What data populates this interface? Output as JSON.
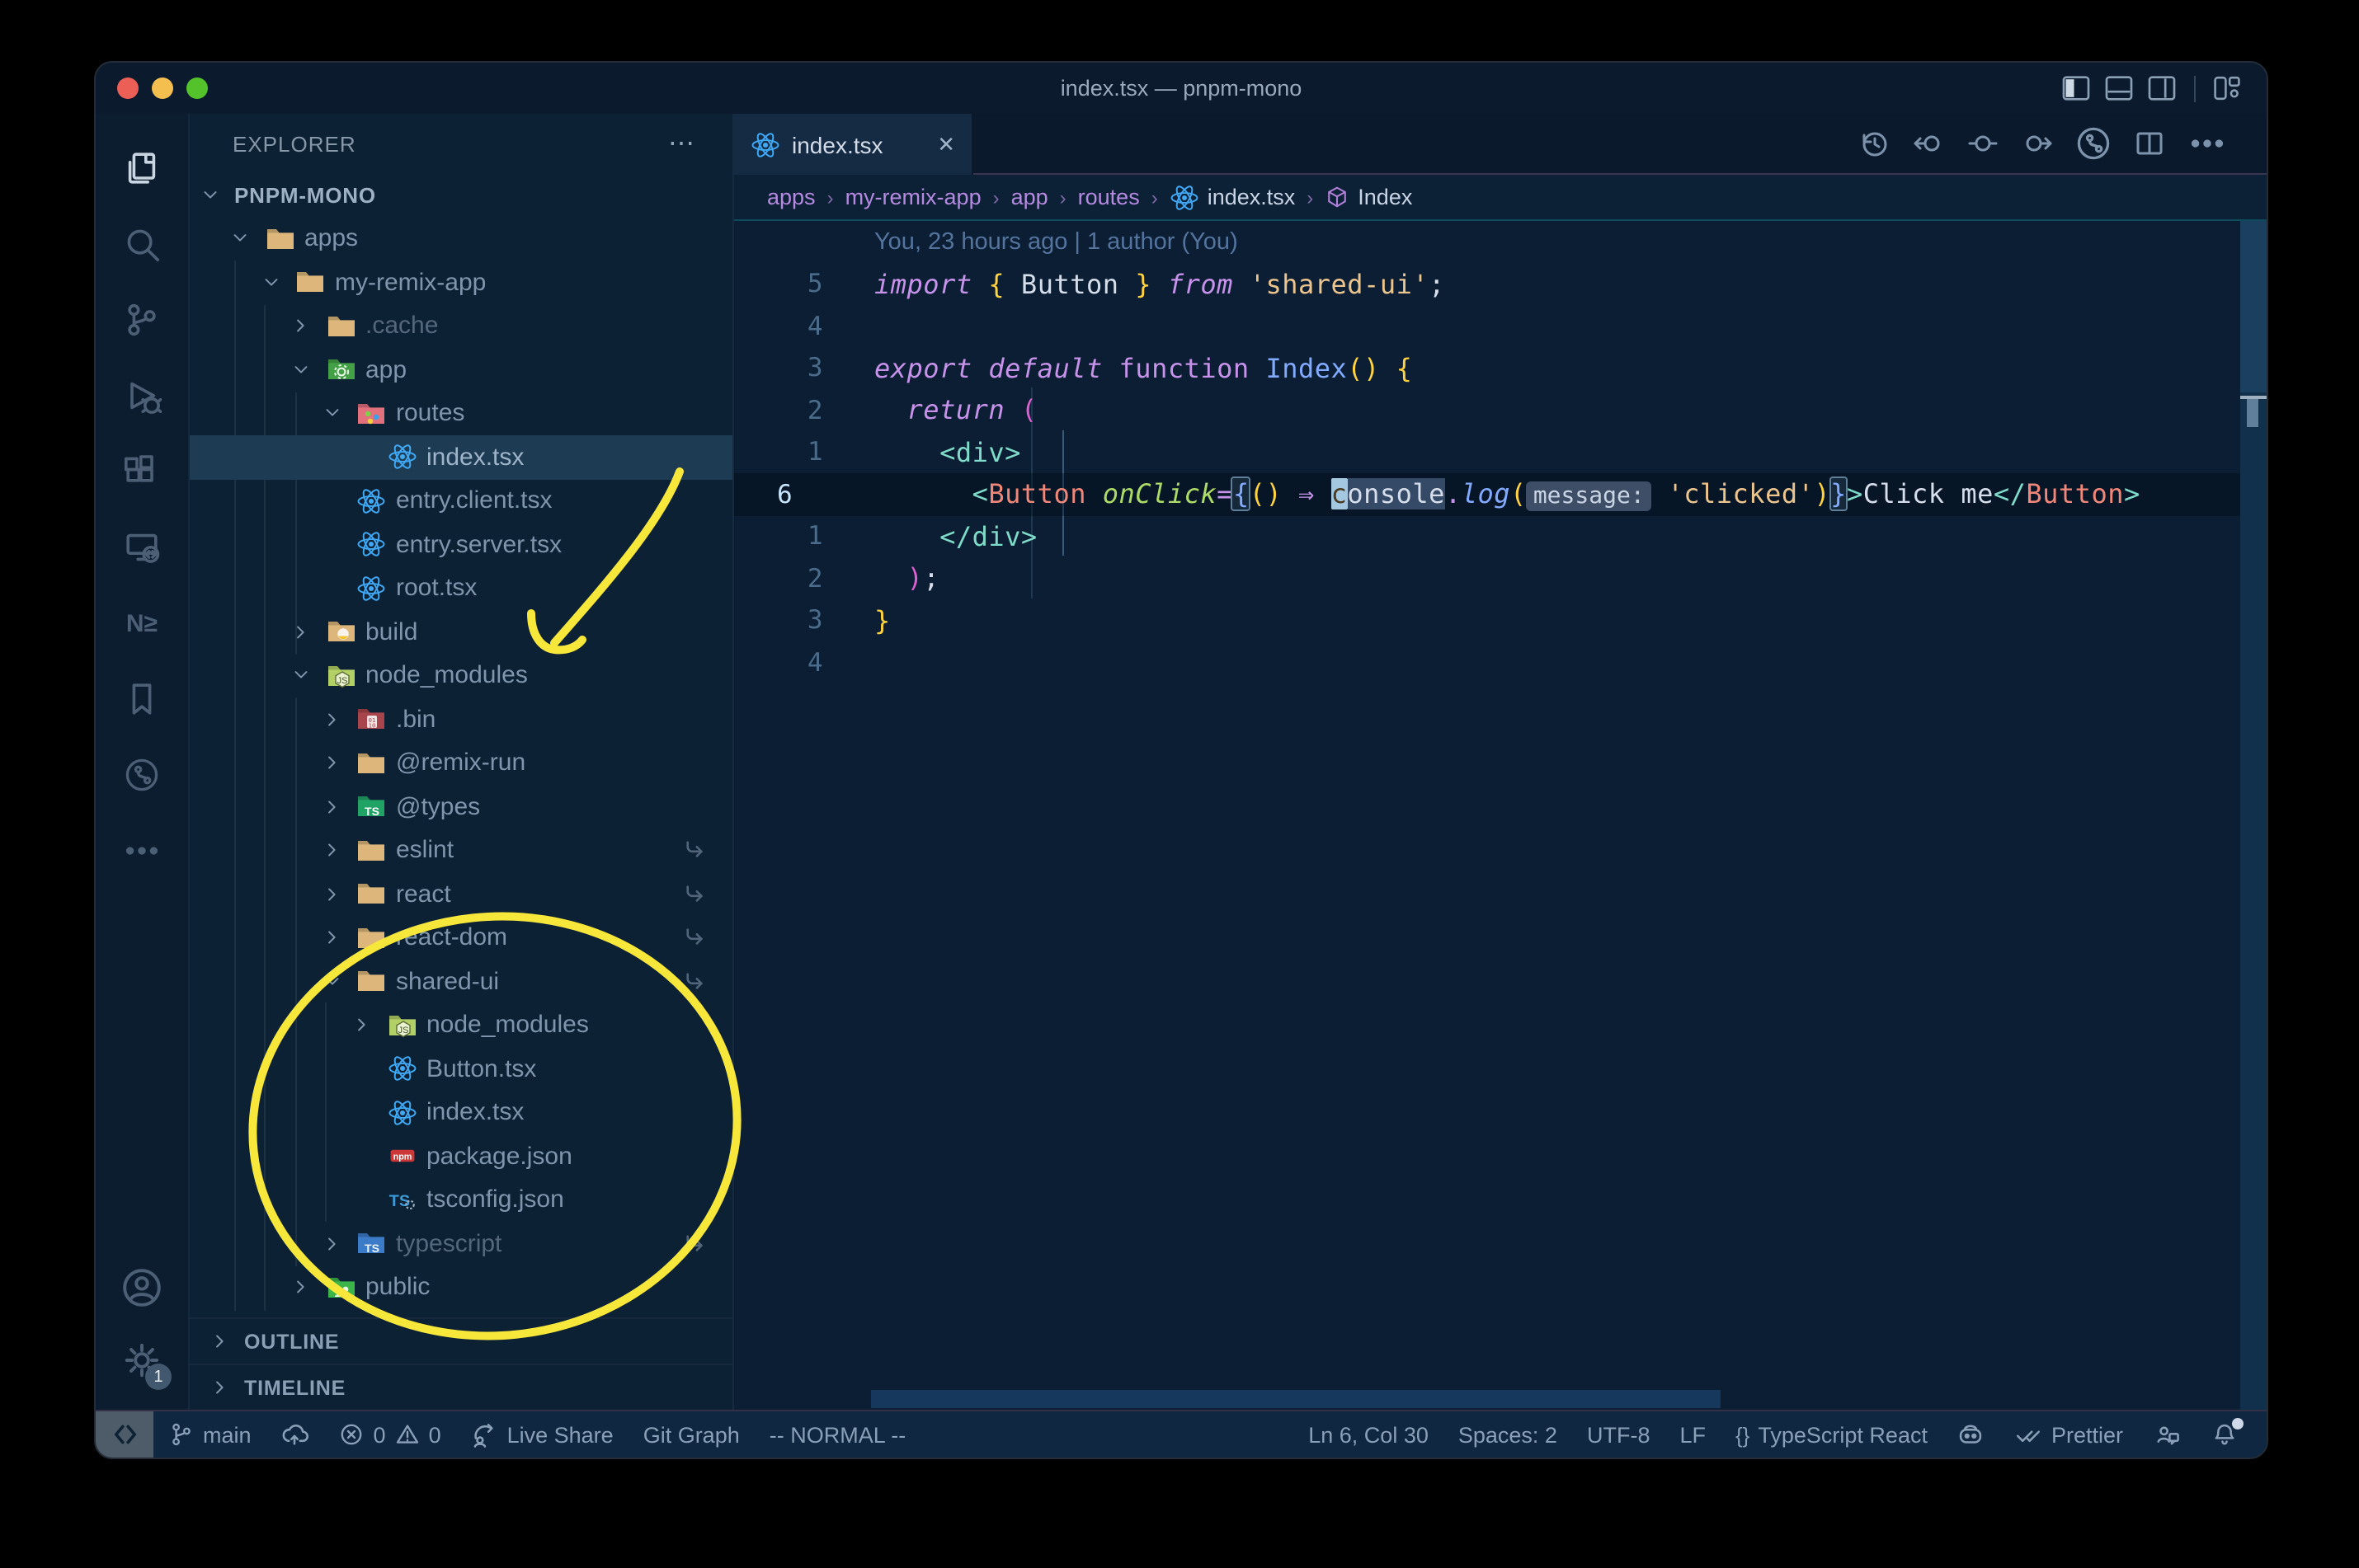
{
  "window": {
    "title": "index.tsx — pnpm-mono"
  },
  "colors": {
    "titlebar-bg": "#0b1b2d",
    "tabbar-bg": "#0a192b",
    "tab-bg": "#152b43",
    "activity-bg": "#0c1d30",
    "sidebar-bg": "#0d2134",
    "editor-bg": "#0b1e33",
    "breadcrumb-bg": "#0c2036",
    "status-bg": "#0f2740",
    "row-sel": "#1d3b53",
    "c-kw": "#c792ea",
    "c-str": "#ecc48d",
    "c-fn": "#82aaff",
    "c-tag": "#7fdbca",
    "c-comp": "#f08779",
    "c-attr": "#addb67",
    "c-gold": "#ffd23f",
    "c-pink": "#de5fd0",
    "code-fg": "#d6deeb",
    "lnum": "#4a6b8a",
    "lnum-cur": "#c5e4fd",
    "blame": "#54749e",
    "inlay-bg": "#3e4e66",
    "inlay-fg": "#c9d4e4",
    "hl-bg": "#354a66",
    "cursor-bg": "#a3c8e0",
    "guide": "#1d3a52",
    "guide-active": "#3a5a78",
    "bc-fg": "#b58ae0",
    "react-blue": "#3fa9f5",
    "annotation-yellow": "#f7e73a",
    "traffic-red": "#ec5f57",
    "traffic-yellow": "#f5bf4f",
    "traffic-green": "#53c22b"
  },
  "titlebar_icons": [
    {
      "name": "toggle-primary-sidebar-icon"
    },
    {
      "name": "toggle-panel-icon"
    },
    {
      "name": "toggle-secondary-sidebar-icon"
    },
    {
      "name": "customize-layout-icon"
    }
  ],
  "activity_bar": {
    "items": [
      {
        "name": "explorer-icon",
        "icon": "files",
        "active": true
      },
      {
        "name": "search-icon",
        "icon": "search"
      },
      {
        "name": "source-control-icon",
        "icon": "scm"
      },
      {
        "name": "run-debug-icon",
        "icon": "debug"
      },
      {
        "name": "extensions-icon",
        "icon": "extensions"
      },
      {
        "name": "remote-explorer-icon",
        "icon": "remote-explorer"
      },
      {
        "name": "nx-console-icon",
        "icon": "nx",
        "glyph": "N≥"
      },
      {
        "name": "bookmarks-icon",
        "icon": "bookmark"
      },
      {
        "name": "git-graph-icon",
        "icon": "gitcircle"
      },
      {
        "name": "more-views-icon",
        "icon": "ellipsis"
      }
    ],
    "bottom": [
      {
        "name": "account-icon",
        "icon": "account"
      },
      {
        "name": "settings-gear-icon",
        "icon": "gear",
        "badge": "1"
      }
    ]
  },
  "sidebar": {
    "header": {
      "title": "EXPLORER",
      "more": "⋯"
    },
    "tree": [
      {
        "label": "PNPM-MONO",
        "level": 0,
        "chevron": "down",
        "icon": "",
        "root": true
      },
      {
        "label": "apps",
        "level": 1,
        "chevron": "down",
        "icon": "folder-tan"
      },
      {
        "label": "my-remix-app",
        "level": 2,
        "chevron": "down",
        "icon": "folder-tan"
      },
      {
        "label": ".cache",
        "level": 3,
        "chevron": "right",
        "icon": "folder-tan",
        "dim": true
      },
      {
        "label": "app",
        "level": 3,
        "chevron": "down",
        "icon": "folder-app"
      },
      {
        "label": "routes",
        "level": 4,
        "chevron": "down",
        "icon": "folder-routes"
      },
      {
        "label": "index.tsx",
        "level": 5,
        "chevron": "none",
        "icon": "react",
        "selected": true
      },
      {
        "label": "entry.client.tsx",
        "level": 4,
        "chevron": "none",
        "icon": "react"
      },
      {
        "label": "entry.server.tsx",
        "level": 4,
        "chevron": "none",
        "icon": "react"
      },
      {
        "label": "root.tsx",
        "level": 4,
        "chevron": "none",
        "icon": "react"
      },
      {
        "label": "build",
        "level": 3,
        "chevron": "right",
        "icon": "folder-build"
      },
      {
        "label": "node_modules",
        "level": 3,
        "chevron": "down",
        "icon": "folder-node"
      },
      {
        "label": ".bin",
        "level": 4,
        "chevron": "right",
        "icon": "folder-bin"
      },
      {
        "label": "@remix-run",
        "level": 4,
        "chevron": "right",
        "icon": "folder-tan"
      },
      {
        "label": "@types",
        "level": 4,
        "chevron": "right",
        "icon": "folder-types"
      },
      {
        "label": "eslint",
        "level": 4,
        "chevron": "right",
        "icon": "folder-tan",
        "symlink": true
      },
      {
        "label": "react",
        "level": 4,
        "chevron": "right",
        "icon": "folder-tan",
        "symlink": true
      },
      {
        "label": "react-dom",
        "level": 4,
        "chevron": "right",
        "icon": "folder-tan",
        "symlink": true
      },
      {
        "label": "shared-ui",
        "level": 4,
        "chevron": "down",
        "icon": "folder-tan",
        "symlink": true
      },
      {
        "label": "node_modules",
        "level": 5,
        "chevron": "right",
        "icon": "folder-node"
      },
      {
        "label": "Button.tsx",
        "level": 5,
        "chevron": "none",
        "icon": "react"
      },
      {
        "label": "index.tsx",
        "level": 5,
        "chevron": "none",
        "icon": "react"
      },
      {
        "label": "package.json",
        "level": 5,
        "chevron": "none",
        "icon": "npm"
      },
      {
        "label": "tsconfig.json",
        "level": 5,
        "chevron": "none",
        "icon": "tsconfig"
      },
      {
        "label": "typescript",
        "level": 4,
        "chevron": "right",
        "icon": "folder-ts",
        "dim": true,
        "symlink": true
      },
      {
        "label": "public",
        "level": 3,
        "chevron": "right",
        "icon": "folder-public"
      }
    ],
    "sections": [
      {
        "label": "OUTLINE"
      },
      {
        "label": "TIMELINE"
      }
    ]
  },
  "tabs": [
    {
      "label": "index.tsx",
      "icon": "react",
      "close": "✕",
      "active": true
    }
  ],
  "editor_toolbar": [
    {
      "name": "timeline-history-icon",
      "icon": "history"
    },
    {
      "name": "previous-change-icon",
      "icon": "prevchange"
    },
    {
      "name": "current-change-icon",
      "icon": "circle"
    },
    {
      "name": "next-change-icon",
      "icon": "nextchange"
    },
    {
      "name": "open-changes-icon",
      "icon": "gitcircle"
    },
    {
      "name": "split-editor-icon",
      "icon": "split"
    },
    {
      "name": "more-actions-icon",
      "icon": "ellipsis"
    }
  ],
  "breadcrumbs": {
    "separator": "›",
    "items": [
      {
        "label": "apps"
      },
      {
        "label": "my-remix-app"
      },
      {
        "label": "app"
      },
      {
        "label": "routes"
      },
      {
        "label": "index.tsx",
        "icon": "react",
        "bright": true
      },
      {
        "label": "Index",
        "icon": "symbol-cube",
        "bright": true
      }
    ]
  },
  "editor": {
    "blame": "You, 23 hours ago | 1 author (You)",
    "current_line_number": "6",
    "lines": [
      {
        "num": "5",
        "tokens": [
          [
            "kw",
            "import"
          ],
          [
            "txt",
            " "
          ],
          [
            "gold",
            "{"
          ],
          [
            "txt",
            " Button "
          ],
          [
            "gold",
            "}"
          ],
          [
            "txt",
            " "
          ],
          [
            "kw",
            "from"
          ],
          [
            "txt",
            " "
          ],
          [
            "str",
            "'shared-ui'"
          ],
          [
            "txt",
            ";"
          ]
        ]
      },
      {
        "num": "4",
        "tokens": []
      },
      {
        "num": "3",
        "tokens": [
          [
            "kw",
            "export"
          ],
          [
            "txt",
            " "
          ],
          [
            "kw",
            "default"
          ],
          [
            "txt",
            " "
          ],
          [
            "kwn",
            "function"
          ],
          [
            "txt",
            " "
          ],
          [
            "fn",
            "Index"
          ],
          [
            "gold",
            "()"
          ],
          [
            "txt",
            " "
          ],
          [
            "gold",
            "{"
          ]
        ]
      },
      {
        "num": "2",
        "tokens": [
          [
            "txt",
            "  "
          ],
          [
            "kw",
            "return"
          ],
          [
            "txt",
            " "
          ],
          [
            "pink",
            "("
          ]
        ]
      },
      {
        "num": "1",
        "tokens": [
          [
            "txt",
            "    "
          ],
          [
            "tag",
            "<div>"
          ]
        ]
      },
      {
        "num": "6",
        "current": true,
        "tokens": [
          [
            "txt",
            "      "
          ],
          [
            "tag",
            "<"
          ],
          [
            "comp",
            "Button"
          ],
          [
            "txt",
            " "
          ],
          [
            "attr",
            "onClick"
          ],
          [
            "op",
            "="
          ],
          [
            "matchL",
            "{"
          ],
          [
            "gold",
            "()"
          ],
          [
            "txt",
            " "
          ],
          [
            "arrow",
            "⇒"
          ],
          [
            "txt",
            " "
          ],
          [
            "cursor",
            "c"
          ],
          [
            "hl",
            "onsole"
          ],
          [
            "op",
            "."
          ],
          [
            "fni",
            "log"
          ],
          [
            "gold",
            "("
          ],
          [
            "inlay",
            "message:"
          ],
          [
            "txt",
            " "
          ],
          [
            "str",
            "'clicked'"
          ],
          [
            "gold",
            ")"
          ],
          [
            "matchR",
            "}"
          ],
          [
            "tag",
            ">"
          ],
          [
            "txt",
            "Click me"
          ],
          [
            "tag",
            "</"
          ],
          [
            "comp",
            "Button"
          ],
          [
            "tag",
            ">"
          ]
        ]
      },
      {
        "num": "1",
        "tokens": [
          [
            "txt",
            "    "
          ],
          [
            "tag",
            "</div>"
          ]
        ]
      },
      {
        "num": "2",
        "tokens": [
          [
            "txt",
            "  "
          ],
          [
            "pink",
            ")"
          ],
          [
            "txt",
            ";"
          ]
        ]
      },
      {
        "num": "3",
        "tokens": [
          [
            "gold",
            "}"
          ]
        ]
      },
      {
        "num": "4",
        "tokens": []
      }
    ]
  },
  "statusbar": {
    "left": [
      {
        "name": "remote-indicator",
        "icon": "remote",
        "remote_box": true
      },
      {
        "name": "git-branch-item",
        "icon": "branch",
        "label": "main"
      },
      {
        "name": "sync-publish-item",
        "icon": "cloud-upload"
      },
      {
        "name": "problems-item",
        "icon": "error",
        "label": "0",
        "icon2": "warning",
        "label2": "0"
      },
      {
        "name": "live-share-item",
        "icon": "liveshare",
        "label": "Live Share"
      },
      {
        "name": "git-graph-item",
        "label": "Git Graph"
      },
      {
        "name": "vim-mode-item",
        "label": "-- NORMAL --"
      }
    ],
    "right": [
      {
        "name": "cursor-position-item",
        "label": "Ln 6, Col 30"
      },
      {
        "name": "indentation-item",
        "label": "Spaces: 2"
      },
      {
        "name": "encoding-item",
        "label": "UTF-8"
      },
      {
        "name": "eol-item",
        "label": "LF"
      },
      {
        "name": "language-mode-item",
        "icon": "braces",
        "label": "TypeScript React"
      },
      {
        "name": "copilot-item",
        "icon": "copilot"
      },
      {
        "name": "formatter-item",
        "icon": "doublecheck",
        "label": "Prettier"
      },
      {
        "name": "feedback-item",
        "icon": "feedback"
      },
      {
        "name": "notifications-bell-item",
        "icon": "bell",
        "badge": true
      }
    ]
  },
  "annotations": {
    "color": "#f7e73a",
    "arrow_points_to": "node_modules",
    "ellipse_encircles": "shared-ui package contents"
  }
}
